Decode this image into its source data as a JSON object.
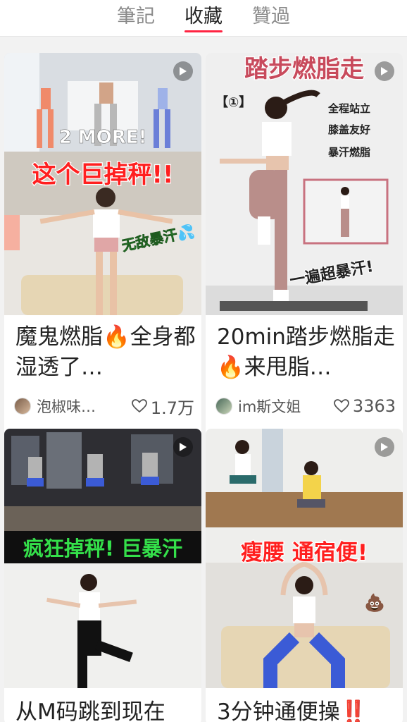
{
  "tabs": [
    {
      "label": "筆記"
    },
    {
      "label": "收藏"
    },
    {
      "label": "贊過"
    }
  ],
  "active_tab": "收藏",
  "cards": [
    {
      "thumb_text": [
        "2 MORE!",
        "这个巨掉秤!!",
        "无敌暴汗💦"
      ],
      "title_parts": [
        "魔鬼燃脂",
        "🔥",
        "全身都湿透了…"
      ],
      "author": "泡椒味…",
      "likes": "1.7万",
      "media_icon": "play-icon"
    },
    {
      "thumb_text": [
        "踏步燃脂走",
        "【①】",
        "全程站立",
        "膝盖友好",
        "暴汗燃脂",
        "一遍超暴汗!"
      ],
      "title_parts": [
        "20min踏步燃脂走",
        "🔥",
        "来甩脂…"
      ],
      "author": "im斯文姐",
      "likes": "3363",
      "media_icon": "play-icon"
    },
    {
      "thumb_text": [
        "疯狂掉秤! 巨暴汗"
      ],
      "title_parts": [
        "从M码跳到现在"
      ],
      "media_icon": "play-icon"
    },
    {
      "thumb_text": [
        "瘦腰 通宿便!"
      ],
      "title_parts": [
        "3分钟通便操",
        "‼️"
      ],
      "media_icon": "play-icon"
    }
  ],
  "colors": {
    "accent": "#ff2442",
    "overlay_red": "#ff1f1f",
    "overlay_green": "#34e04a"
  }
}
